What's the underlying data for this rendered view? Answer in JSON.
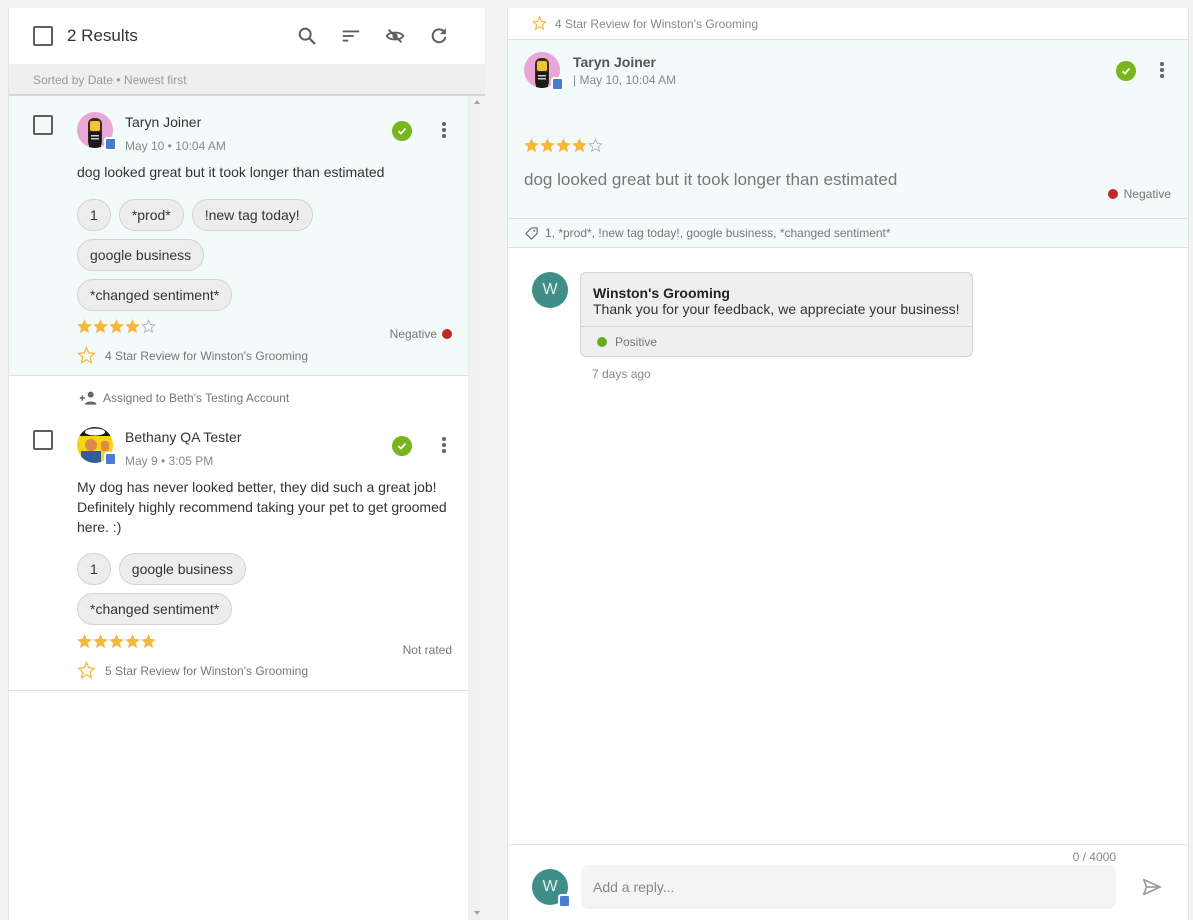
{
  "list_header": {
    "results_label": "2 Results",
    "icons": [
      "search-icon",
      "filter-sort-icon",
      "visibility-off-icon",
      "refresh-icon"
    ],
    "sort_label": "Sorted by Date • Newest first"
  },
  "reviews": [
    {
      "selected": true,
      "reviewer": "Taryn Joiner",
      "date": "May 10 • 10:04 AM",
      "text": "dog looked great but it took longer than estimated",
      "tags": [
        "1",
        "*prod*",
        "!new tag today!",
        "google business",
        "*changed sentiment*"
      ],
      "rating": 4,
      "max_rating": 5,
      "sentiment": "Negative",
      "sentiment_color": "#c62828",
      "review_for": "4 Star Review for Winston's Grooming",
      "status": "approved"
    },
    {
      "selected": false,
      "assigned_to": "Assigned to Beth's Testing Account",
      "reviewer": "Bethany QA Tester",
      "date": "May 9 • 3:05 PM",
      "text": "My dog has never looked better, they did such a great job! Definitely highly recommend taking your pet to get groomed here. :)",
      "tags": [
        "1",
        "google business",
        "*changed sentiment*"
      ],
      "rating": 5,
      "max_rating": 5,
      "sentiment": "Not rated",
      "review_for": "5 Star Review for Winston's Grooming",
      "status": "approved"
    }
  ],
  "detail": {
    "topbar_label": "4 Star Review for Winston's Grooming",
    "reviewer": "Taryn Joiner",
    "date": "| May 10, 10:04 AM",
    "rating": 4,
    "text": "dog looked great but it took longer than estimated",
    "sentiment": "Negative",
    "sentiment_color": "#c62828",
    "tags_line": "1, *prod*, !new tag today!, google business, *changed sentiment*",
    "reply": {
      "avatar_letter": "W",
      "author": "Winston's Grooming",
      "text": "Thank you for your feedback, we appreciate your business!",
      "sentiment": "Positive",
      "sentiment_color": "#6aaa1e",
      "time": "7 days ago"
    },
    "composer": {
      "avatar_letter": "W",
      "char_count": "0 / 4000",
      "placeholder": "Add a reply...",
      "value": ""
    }
  },
  "colors": {
    "accent_teal": "#3f8f88",
    "approved_green": "#79b51c",
    "star_gold": "#f6b73c",
    "selected_bg": "#f2fafa"
  }
}
